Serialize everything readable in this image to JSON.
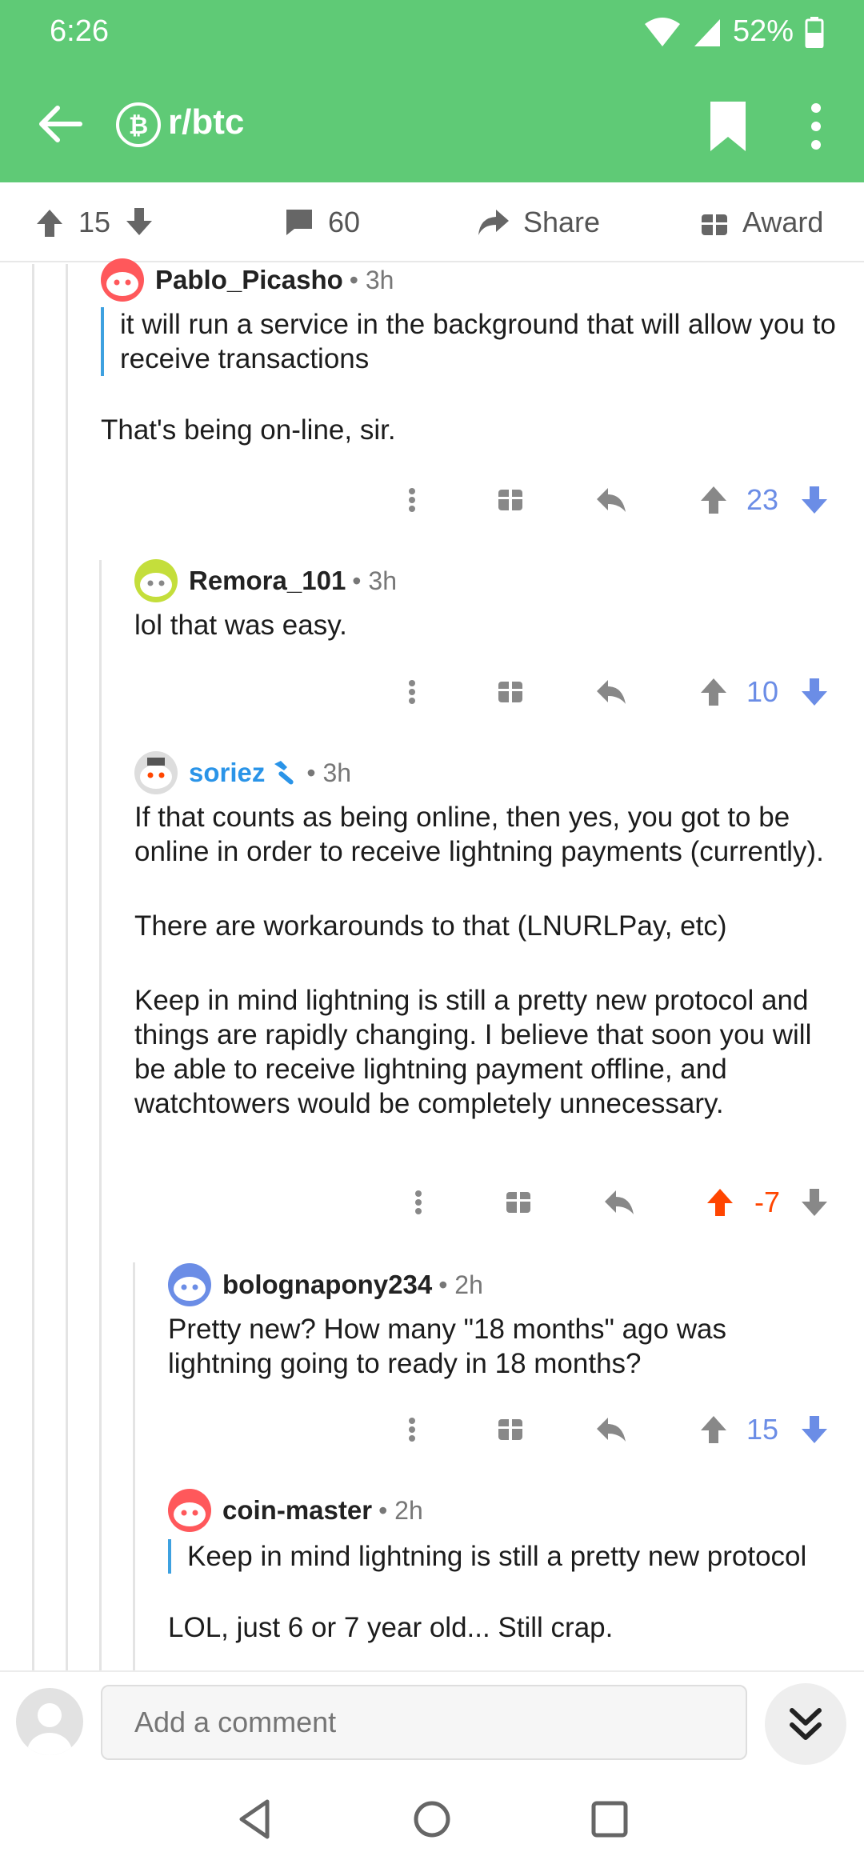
{
  "status": {
    "time": "6:26",
    "battery": "52%"
  },
  "header": {
    "subreddit": "r/btc"
  },
  "post_actions": {
    "upvotes": "15",
    "comments": "60",
    "share": "Share",
    "award": "Award"
  },
  "comments": [
    {
      "author": "Pablo_Picasho",
      "age": "3h",
      "quote": "it will run a service in the background that will allow you to receive transactions",
      "text": "That's being on-line, sir.",
      "score": "23",
      "vote": "none"
    },
    {
      "author": "Remora_101",
      "age": "3h",
      "text": "lol that was easy.",
      "score": "10",
      "vote": "none"
    },
    {
      "author": "soriez",
      "age": "3h",
      "moderator": true,
      "paragraphs": [
        "If that counts as being online, then yes, you got to be online in order to receive lightning payments (currently).",
        "There are workarounds to that (LNURLPay, etc)",
        "Keep in mind lightning is still a pretty new protocol and things are rapidly changing. I believe that soon you will be able to receive lightning payment offline, and watchtowers would be completely unnecessary."
      ],
      "score": "-7",
      "vote": "up"
    },
    {
      "author": "bolognapony234",
      "age": "2h",
      "text": "Pretty new? How many \"18 months\" ago was lightning going to ready in 18 months?",
      "score": "15",
      "vote": "none"
    },
    {
      "author": "coin-master",
      "age": "2h",
      "quote": "Keep in mind lightning is still a pretty new protocol",
      "text": "LOL, just 6 or 7 year old... Still crap."
    }
  ],
  "comment_bar": {
    "placeholder": "Add a comment"
  },
  "colors": {
    "brand_green": "#5fca76",
    "score_blue": "#6b8de6",
    "upvote_orange": "#ff4500",
    "mod_blue": "#2a94e8",
    "quote_bar": "#3ea1e0"
  },
  "icons": [
    "back-arrow-icon",
    "bitcoin-icon",
    "bookmark-icon",
    "more-vertical-icon",
    "upvote-icon",
    "downvote-icon",
    "comment-icon",
    "share-icon",
    "gift-icon",
    "reply-icon",
    "double-chevron-down-icon"
  ]
}
